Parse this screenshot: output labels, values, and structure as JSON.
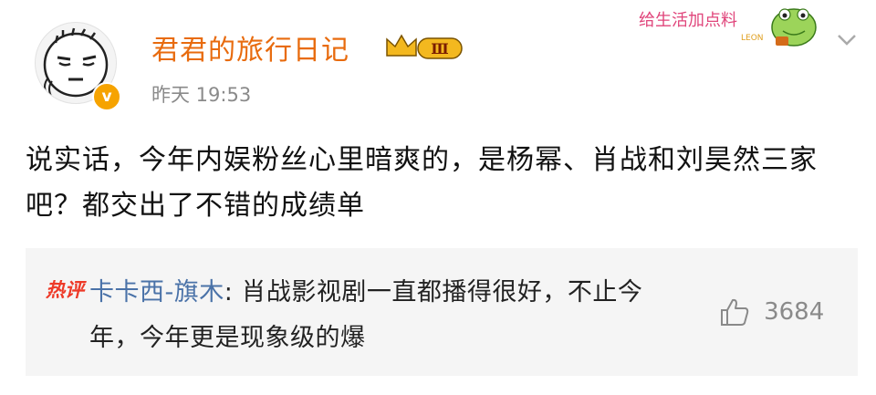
{
  "post": {
    "username": "君君的旅行日记",
    "badge_level": "Ⅲ",
    "timestamp": "昨天 19:53",
    "content": "说实话，今年内娱粉丝心里暗爽的，是杨幂、肖战和刘昊然三家吧？都交出了不错的成绩单",
    "avatar_icon": "cartoon-face-avatar",
    "verified_icon": "v"
  },
  "sticker": {
    "text": "给生活加点料",
    "sub": "LEON"
  },
  "hot_comment": {
    "tag": "热评",
    "author": "卡卡西-旗木",
    "separator": ": ",
    "text": "肖战影视剧一直都播得很好，不止今年，今年更是现象级的爆",
    "like_count": "3684"
  },
  "colors": {
    "username": "#e86b0e",
    "hot_tag": "#ee3a28",
    "comment_author": "#4a72a8",
    "comment_bg": "#f5f5f5"
  }
}
